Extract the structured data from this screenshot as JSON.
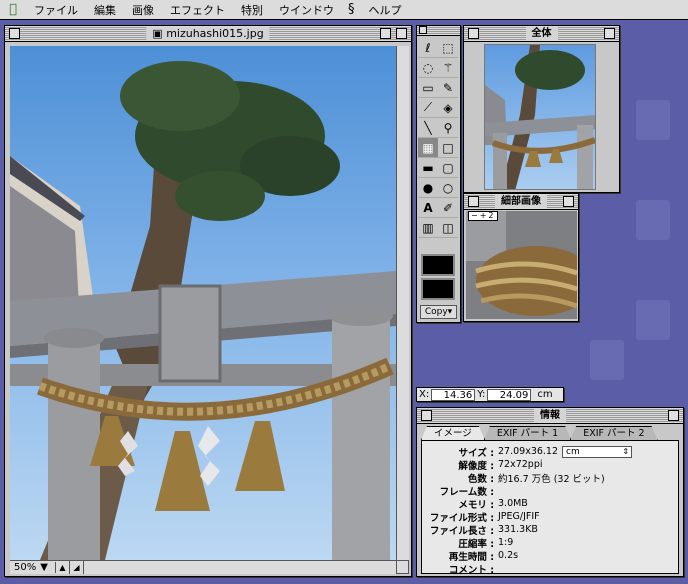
{
  "menubar": {
    "items": [
      "ファイル",
      "編集",
      "画像",
      "エフェクト",
      "特別",
      "ウインドウ",
      "ヘルプ"
    ]
  },
  "document": {
    "title": "mizuhashi015.jpg",
    "zoom": "50%"
  },
  "tools": {
    "copy_label": "Copy"
  },
  "navigator": {
    "title": "全体"
  },
  "loupe": {
    "title": "細部画像",
    "zoom_badge": "2"
  },
  "coords": {
    "x_label": "X:",
    "x_value": "14.36",
    "y_label": "Y:",
    "y_value": "24.09",
    "unit": "cm"
  },
  "info": {
    "title": "情報",
    "tabs": [
      "イメージ",
      "EXIF パート 1",
      "EXIF パート 2"
    ],
    "active_tab": 0,
    "unit_select": "cm",
    "rows": [
      {
        "label": "サイズ :",
        "value": "27.09x36.12"
      },
      {
        "label": "解像度 :",
        "value": "72x72ppi"
      },
      {
        "label": "色数 :",
        "value": "約16.7 万色 (32 ビット)"
      },
      {
        "label": "フレーム数 :",
        "value": ""
      },
      {
        "label": "メモリ :",
        "value": "3.0MB"
      },
      {
        "label": "ファイル形式 :",
        "value": "JPEG/JFIF"
      },
      {
        "label": "ファイル長さ :",
        "value": "331.3KB"
      },
      {
        "label": "圧縮率 :",
        "value": "1:9"
      },
      {
        "label": "再生時間 :",
        "value": "0.2s"
      },
      {
        "label": "コメント :",
        "value": ""
      }
    ]
  }
}
